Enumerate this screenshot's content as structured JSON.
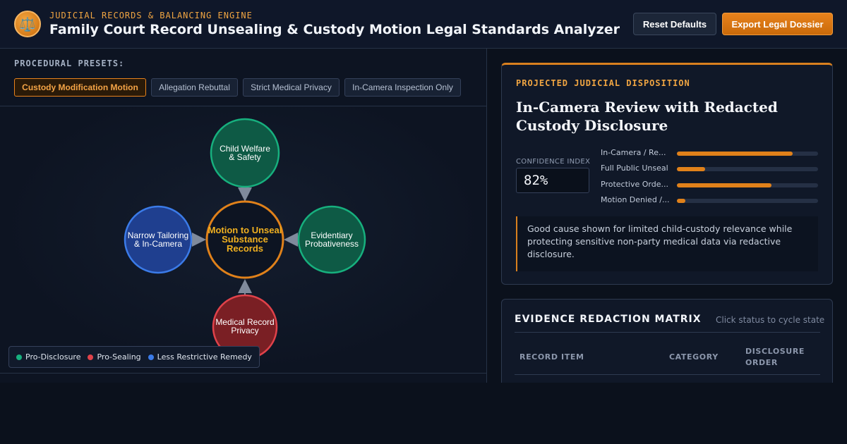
{
  "header": {
    "logo_icon": "⚖️",
    "eyebrow": "JUDICIAL RECORDS & BALANCING ENGINE",
    "title": "Family Court Record Unsealing & Custody Motion Legal Standards Analyzer",
    "reset_label": "Reset Defaults",
    "export_label": "Export Legal Dossier"
  },
  "presets": {
    "heading": "PROCEDURAL PRESETS:",
    "items": [
      {
        "label": "Custody Modification Motion",
        "active": true
      },
      {
        "label": "Allegation Rebuttal",
        "active": false
      },
      {
        "label": "Strict Medical Privacy",
        "active": false
      },
      {
        "label": "In-Camera Inspection Only",
        "active": false
      }
    ]
  },
  "graph": {
    "center": {
      "label_lines": [
        "Motion to Unseal",
        "Substance",
        "Records"
      ],
      "stroke": "#e0811a",
      "text_color": "#f0b020"
    },
    "nodes": [
      {
        "id": "child-welfare",
        "label_lines": [
          "Child Welfare",
          "& Safety"
        ],
        "type": "pro-disclosure"
      },
      {
        "id": "narrow-tailoring",
        "label_lines": [
          "Narrow Tailoring",
          "& In-Camera"
        ],
        "type": "less-restrictive"
      },
      {
        "id": "evidentiary",
        "label_lines": [
          "Evidentiary",
          "Probativeness"
        ],
        "type": "pro-disclosure"
      },
      {
        "id": "medical-privacy",
        "label_lines": [
          "Medical Record",
          "Privacy"
        ],
        "type": "pro-sealing"
      }
    ],
    "colors": {
      "pro-disclosure": {
        "fill": "#0e5a45",
        "stroke": "#17b07e"
      },
      "pro-sealing": {
        "fill": "#7a1f24",
        "stroke": "#e0424a"
      },
      "less-restrictive": {
        "fill": "#1f3f8f",
        "stroke": "#3b7be8"
      }
    }
  },
  "legend": {
    "items": [
      {
        "label": "Pro-Disclosure",
        "color": "#17b07e"
      },
      {
        "label": "Pro-Sealing",
        "color": "#e0424a"
      },
      {
        "label": "Less Restrictive Remedy",
        "color": "#3b7be8"
      }
    ]
  },
  "disposition": {
    "heading": "PROJECTED JUDICIAL DISPOSITION",
    "title": "In-Camera Review with Redacted Custody Disclosure",
    "confidence_label": "CONFIDENCE INDEX",
    "confidence_value": "82%",
    "outcomes": [
      {
        "label": "In-Camera / Re...",
        "level": 0.82
      },
      {
        "label": "Full Public Unseal",
        "level": 0.2
      },
      {
        "label": "Protective Orde...",
        "level": 0.67
      },
      {
        "label": "Motion Denied /...",
        "level": 0.06
      }
    ],
    "rationale": "Good cause shown for limited child-custody relevance while protecting sensitive non-party medical data via redactive disclosure."
  },
  "matrix": {
    "title": "EVIDENCE REDACTION MATRIX",
    "hint": "Click status to cycle state",
    "columns": [
      "RECORD ITEM",
      "CATEGORY",
      "DISCLOSURE ORDER"
    ]
  }
}
